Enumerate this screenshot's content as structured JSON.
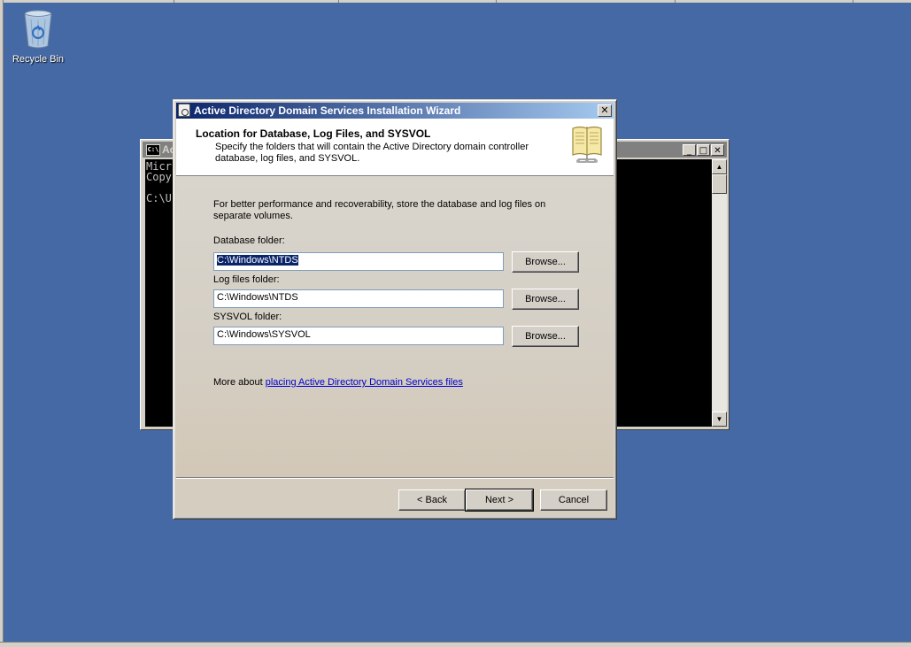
{
  "desktop": {
    "recycle_bin_label": "Recycle Bin"
  },
  "console": {
    "title": "Ac",
    "icon_text": "C:\\",
    "lines": [
      "Micr",
      "Copy",
      "",
      "C:\\U"
    ]
  },
  "wizard": {
    "title": "Active Directory Domain Services Installation Wizard",
    "close_glyph": "✕",
    "header": {
      "title": "Location for Database, Log Files, and SYSVOL",
      "description": "Specify the folders that will contain the Active Directory domain controller database, log files, and SYSVOL."
    },
    "intro": "For better performance and recoverability, store the database and log files on separate volumes.",
    "fields": {
      "database": {
        "label": "Database folder:",
        "value": "C:\\Windows\\NTDS"
      },
      "logs": {
        "label": "Log files folder:",
        "value": "C:\\Windows\\NTDS"
      },
      "sysvol": {
        "label": "SYSVOL folder:",
        "value": "C:\\Windows\\SYSVOL"
      }
    },
    "browse_label": "Browse...",
    "more_prefix": "More about ",
    "more_link": "placing Active Directory Domain Services files",
    "buttons": {
      "back": "< Back",
      "next": "Next >",
      "cancel": "Cancel"
    }
  },
  "colors": {
    "desktop": "#4569a4",
    "title_bar_start": "#0a246a",
    "title_bar_end": "#a6caf0",
    "link": "#0000cc"
  }
}
